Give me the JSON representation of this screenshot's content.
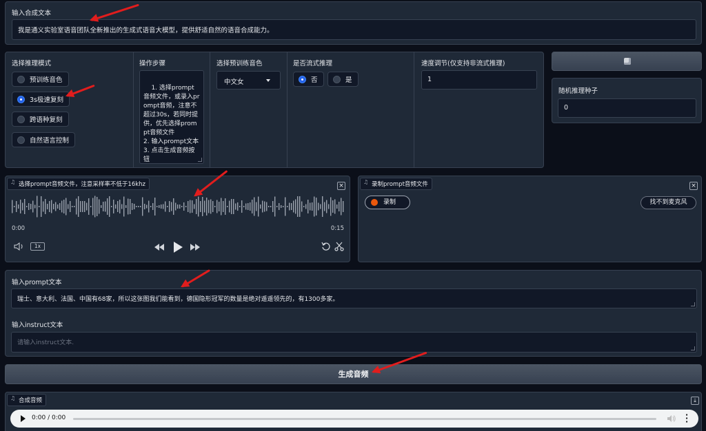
{
  "synth_text": {
    "label": "输入合成文本",
    "value": "我是通义实验室语音团队全新推出的生成式语音大模型，提供舒适自然的语音合成能力。"
  },
  "mode": {
    "label": "选择推理模式",
    "options": [
      "预训练音色",
      "3s极速复刻",
      "跨语种复刻",
      "自然语言控制"
    ],
    "selected": "3s极速复刻"
  },
  "steps": {
    "label": "操作步骤",
    "text": "1. 选择prompt音频文件，或录入prompt音频，注意不超过30s，若同时提供，优先选择prompt音频文件\n2. 输入prompt文本\n3. 点击生成音频按钮"
  },
  "voice": {
    "label": "选择预训练音色",
    "value": "中文女"
  },
  "stream": {
    "label": "是否流式推理",
    "options": [
      "否",
      "是"
    ],
    "selected": "否"
  },
  "speed": {
    "label": "速度调节(仅支持非流式推理)",
    "value": "1"
  },
  "seed": {
    "label": "随机推理种子",
    "value": "0"
  },
  "icons": {
    "dice": "dice-icon",
    "note": "music-note-icon",
    "close": "close-icon",
    "download": "download-icon"
  },
  "upload": {
    "tag": "选择prompt音频文件，注意采样率不低于16khz",
    "time_start": "0:00",
    "time_end": "0:15",
    "rate": "1x"
  },
  "record": {
    "tag": "录制prompt音频文件",
    "record_label": "录制",
    "mic_label": "找不到麦克风"
  },
  "prompt_text": {
    "label": "输入prompt文本",
    "value": "瑞士、意大利、法国、中国有68家，所以这张图我们能看到，德国隐形冠军的数量是绝对遥遥领先的，有1300多家。"
  },
  "instruct": {
    "label": "输入instruct文本",
    "placeholder": "请输入instruct文本."
  },
  "generate": {
    "label": "生成音频"
  },
  "output": {
    "tag": "合成音频",
    "time": "0:00 / 0:00"
  },
  "colors": {
    "accent": "#2563eb",
    "record": "#ea580c",
    "arrow": "#e11d1d"
  }
}
